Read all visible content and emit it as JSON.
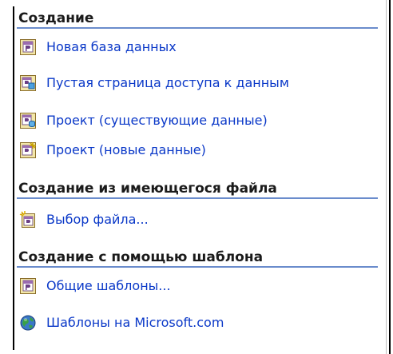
{
  "sections": [
    {
      "header": "Создание",
      "items": [
        {
          "label": "Новая база данных",
          "icon": "access-database-icon"
        },
        {
          "label": "Пустая страница доступа к данным",
          "icon": "data-access-page-icon"
        },
        {
          "label": "Проект (существующие данные)",
          "icon": "project-existing-data-icon"
        },
        {
          "label": "Проект (новые данные)",
          "icon": "project-new-data-icon"
        }
      ]
    },
    {
      "header": "Создание из имеющегося файла",
      "items": [
        {
          "label": "Выбор файла...",
          "icon": "open-file-icon"
        }
      ]
    },
    {
      "header": "Создание с помощью шаблона",
      "items": [
        {
          "label": "Общие шаблоны...",
          "icon": "general-templates-icon"
        },
        {
          "label": "Шаблоны на Microsoft.com",
          "icon": "globe-icon"
        }
      ]
    }
  ],
  "colors": {
    "link": "#0a38c8",
    "header_rule": "#6a8ccc",
    "header_text": "#1a1a1a"
  }
}
